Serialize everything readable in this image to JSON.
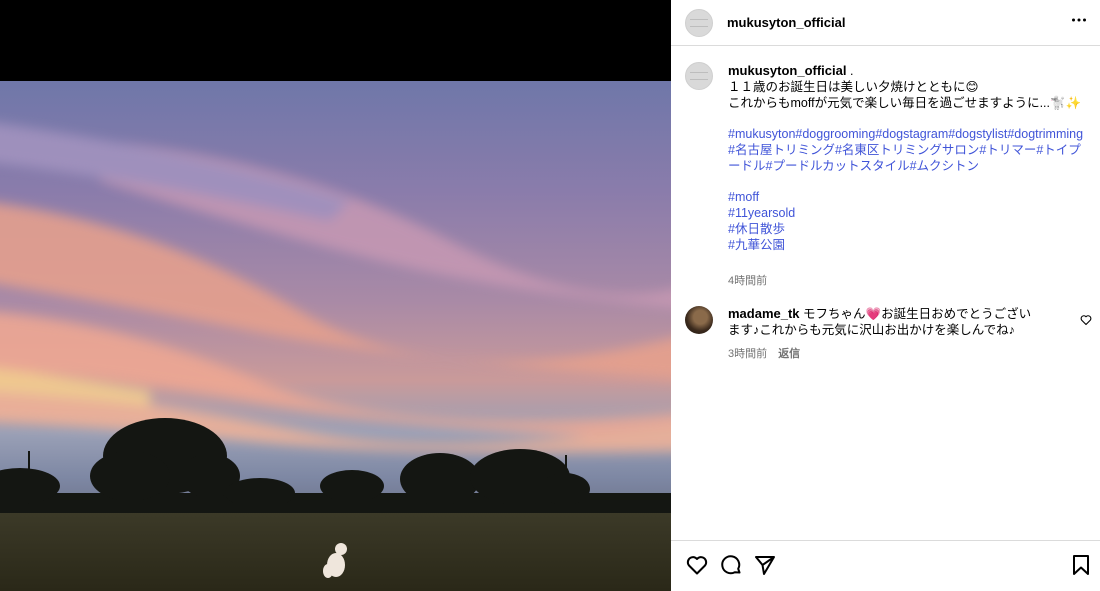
{
  "post": {
    "username": "mukusyton_official",
    "more_icon": "more-dots-icon"
  },
  "caption": {
    "username": "mukusyton_official",
    "username_suffix": " .",
    "line1": "１１歳のお誕生日は美しい夕焼けとともに😊",
    "line2": "これからもmoffが元気で楽しい毎日を過ごせますように...🐩✨",
    "hashtags_block1": "#mukusyton#doggrooming#dogstagram#dogstylist#dogtrimming",
    "hashtags_block2": "#名古屋トリミング#名東区トリミングサロン#トリマー#トイプードル#プードルカットスタイル#ムクシトン",
    "tags": [
      "#moff",
      "#11yearsold",
      "#休日散歩",
      "#九華公園"
    ],
    "time": "4時間前"
  },
  "comment": {
    "username": "madame_tk",
    "text": " モフちゃん💗お誕生日おめでとうございます♪これからも元気に沢山お出かけを楽しんでね♪",
    "time": "3時間前",
    "reply_label": "返信"
  },
  "actions": {
    "like_icon": "heart-icon",
    "comment_icon": "comment-icon",
    "share_icon": "send-icon",
    "save_icon": "bookmark-icon"
  },
  "colors": {
    "hashtag": "#4054d8",
    "meta": "#737373",
    "border": "#dbdbdb"
  }
}
